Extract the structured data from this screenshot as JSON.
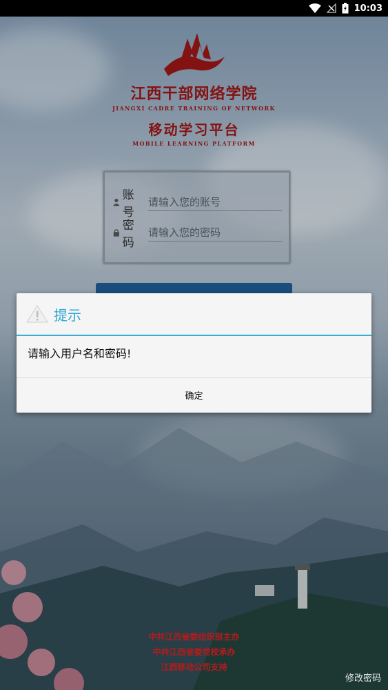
{
  "status_bar": {
    "time": "10:03",
    "icons": [
      "wifi-icon",
      "no-signal-icon",
      "battery-charging-icon"
    ]
  },
  "branding": {
    "title": "江西干部网络学院",
    "title_en": "JIANGXI  CADRE  TRAINING  OF  NETWORK",
    "subtitle": "移动学习平台",
    "subtitle_en": "MOBILE  LEARNING  PLATFORM",
    "logo_color": "#9a1616"
  },
  "login": {
    "account_label": "账号",
    "account_placeholder": "请输入您的账号",
    "account_value": "",
    "password_label": "密码",
    "password_placeholder": "请输入您的密码",
    "password_value": "",
    "button_color": "#1e5b93"
  },
  "dialog": {
    "title": "提示",
    "message": "请输入用户名和密码!",
    "confirm_label": "确定",
    "accent": "#2ea7d6"
  },
  "footer": {
    "lines": [
      "中共江西省委组织部主办",
      "中共江西省委党校承办",
      "江西移动公司支持"
    ],
    "modify_password": "修改密码"
  }
}
